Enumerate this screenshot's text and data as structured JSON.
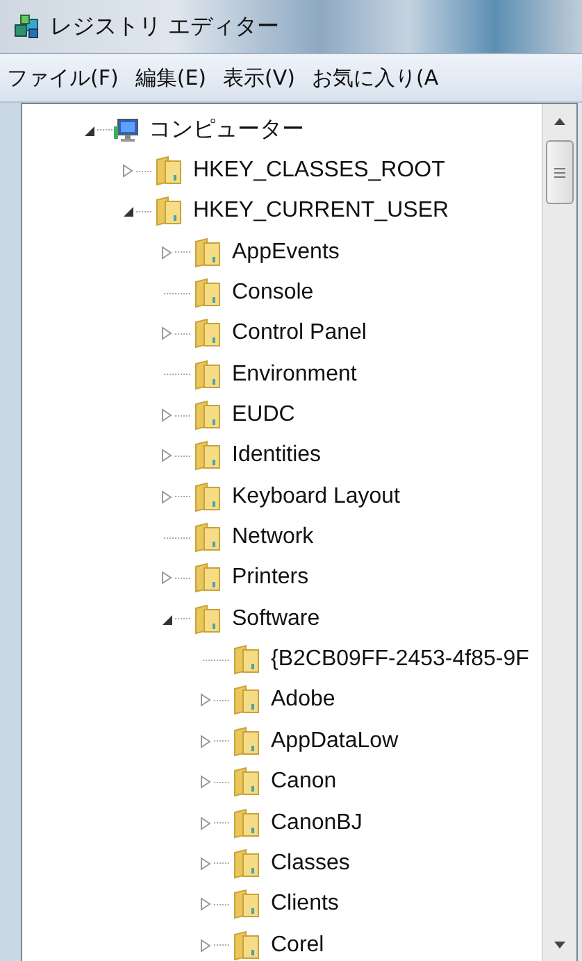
{
  "window": {
    "title": "レジストリ エディター"
  },
  "menu": [
    {
      "label": "ファイル(F)"
    },
    {
      "label": "編集(E)"
    },
    {
      "label": "表示(V)"
    },
    {
      "label": "お気に入り(A"
    }
  ],
  "tree": [
    {
      "label": "コンピューター",
      "kind": "computer",
      "expanded": true,
      "children": [
        {
          "label": "HKEY_CLASSES_ROOT",
          "kind": "branch",
          "expanded": false
        },
        {
          "label": "HKEY_CURRENT_USER",
          "kind": "branch",
          "expanded": true,
          "children": [
            {
              "label": "AppEvents",
              "kind": "branch",
              "expanded": false
            },
            {
              "label": "Console",
              "kind": "leaf"
            },
            {
              "label": "Control Panel",
              "kind": "branch",
              "expanded": false
            },
            {
              "label": "Environment",
              "kind": "leaf"
            },
            {
              "label": "EUDC",
              "kind": "branch",
              "expanded": false
            },
            {
              "label": "Identities",
              "kind": "branch",
              "expanded": false
            },
            {
              "label": "Keyboard Layout",
              "kind": "branch",
              "expanded": false
            },
            {
              "label": "Network",
              "kind": "leaf"
            },
            {
              "label": "Printers",
              "kind": "branch",
              "expanded": false
            },
            {
              "label": "Software",
              "kind": "branch",
              "expanded": true,
              "children": [
                {
                  "label": "{B2CB09FF-2453-4f85-9F",
                  "kind": "leaf"
                },
                {
                  "label": "Adobe",
                  "kind": "branch",
                  "expanded": false
                },
                {
                  "label": "AppDataLow",
                  "kind": "branch",
                  "expanded": false
                },
                {
                  "label": "Canon",
                  "kind": "branch",
                  "expanded": false
                },
                {
                  "label": "CanonBJ",
                  "kind": "branch",
                  "expanded": false
                },
                {
                  "label": "Classes",
                  "kind": "branch",
                  "expanded": false
                },
                {
                  "label": "Clients",
                  "kind": "branch",
                  "expanded": false
                },
                {
                  "label": "Corel",
                  "kind": "branch",
                  "expanded": false
                }
              ]
            }
          ]
        }
      ]
    }
  ]
}
